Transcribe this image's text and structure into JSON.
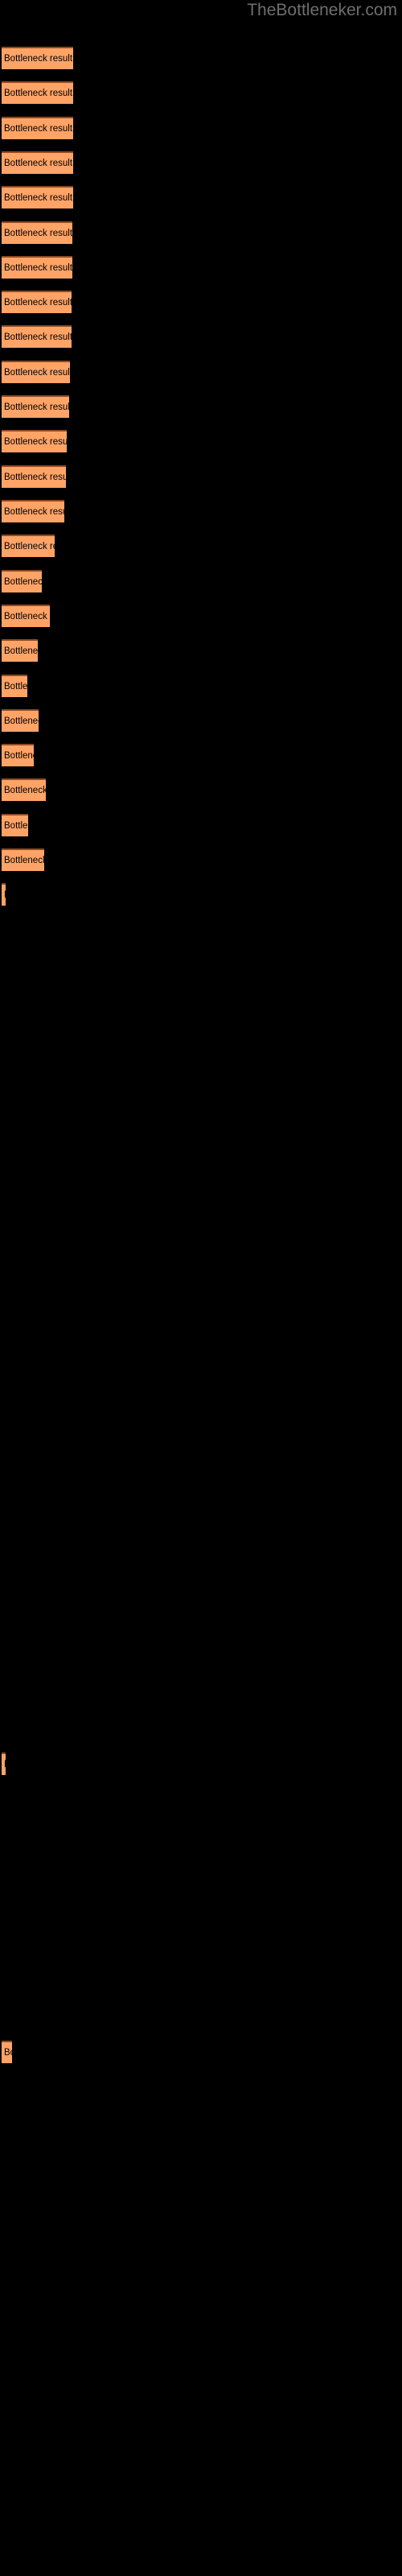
{
  "watermark": {
    "text": "TheBottleneker.com"
  },
  "colors": {
    "background": "#000000",
    "bar_fill": "#ffa366",
    "bar_edge": "#8f4a20",
    "label_text": "#000000",
    "watermark_text": "#6e6e6e"
  },
  "bar_label": "Bottleneck result",
  "chart_data": {
    "type": "bar",
    "orientation": "horizontal",
    "title": "",
    "subtitle": "",
    "xlabel": "",
    "ylabel": "",
    "grid": false,
    "legend": null,
    "axis_visible": false,
    "tick_labels": [],
    "bar_text": "Bottleneck result",
    "xlim": [
      0,
      500
    ],
    "categories": [
      "bar-1",
      "bar-2",
      "bar-3",
      "bar-4",
      "bar-5",
      "bar-6",
      "bar-7",
      "bar-8",
      "bar-9",
      "bar-10",
      "bar-11",
      "bar-12",
      "bar-13",
      "bar-14",
      "bar-15",
      "bar-16",
      "bar-17",
      "bar-18",
      "bar-19",
      "bar-20",
      "bar-21",
      "bar-22",
      "bar-23",
      "bar-24",
      "bar-25",
      "bar-26",
      "bar-27"
    ],
    "values": [
      89,
      89,
      89,
      89,
      89,
      88,
      88,
      87,
      87,
      85,
      84,
      81,
      80,
      78,
      66,
      50,
      60,
      45,
      32,
      46,
      40,
      55,
      33,
      53,
      5,
      5,
      13
    ],
    "bars": [
      {
        "name": "bar-1",
        "top": 58,
        "width": 89,
        "height": 28,
        "label": "Bottleneck result"
      },
      {
        "name": "bar-2",
        "top": 101,
        "width": 89,
        "height": 28,
        "label": "Bottleneck result"
      },
      {
        "name": "bar-3",
        "top": 145,
        "width": 89,
        "height": 28,
        "label": "Bottleneck result"
      },
      {
        "name": "bar-4",
        "top": 188,
        "width": 89,
        "height": 28,
        "label": "Bottleneck result"
      },
      {
        "name": "bar-5",
        "top": 231,
        "width": 89,
        "height": 28,
        "label": "Bottleneck result"
      },
      {
        "name": "bar-6",
        "top": 275,
        "width": 88,
        "height": 28,
        "label": "Bottleneck result"
      },
      {
        "name": "bar-7",
        "top": 318,
        "width": 88,
        "height": 28,
        "label": "Bottleneck result"
      },
      {
        "name": "bar-8",
        "top": 361,
        "width": 87,
        "height": 28,
        "label": "Bottleneck result"
      },
      {
        "name": "bar-9",
        "top": 404,
        "width": 87,
        "height": 28,
        "label": "Bottleneck result"
      },
      {
        "name": "bar-10",
        "top": 448,
        "width": 85,
        "height": 28,
        "label": "Bottleneck result"
      },
      {
        "name": "bar-11",
        "top": 491,
        "width": 84,
        "height": 28,
        "label": "Bottleneck result"
      },
      {
        "name": "bar-12",
        "top": 534,
        "width": 81,
        "height": 28,
        "label": "Bottleneck result"
      },
      {
        "name": "bar-13",
        "top": 578,
        "width": 80,
        "height": 28,
        "label": "Bottleneck result"
      },
      {
        "name": "bar-14",
        "top": 621,
        "width": 78,
        "height": 28,
        "label": "Bottleneck result"
      },
      {
        "name": "bar-15",
        "top": 664,
        "width": 66,
        "height": 28,
        "label": "Bottleneck result"
      },
      {
        "name": "bar-16",
        "top": 708,
        "width": 50,
        "height": 28,
        "label": "Bottleneck result"
      },
      {
        "name": "bar-17",
        "top": 751,
        "width": 60,
        "height": 28,
        "label": "Bottleneck result"
      },
      {
        "name": "bar-18",
        "top": 794,
        "width": 45,
        "height": 28,
        "label": "Bottleneck result"
      },
      {
        "name": "bar-19",
        "top": 838,
        "width": 32,
        "height": 28,
        "label": "Bottleneck result"
      },
      {
        "name": "bar-20",
        "top": 881,
        "width": 46,
        "height": 28,
        "label": "Bottleneck result"
      },
      {
        "name": "bar-21",
        "top": 924,
        "width": 40,
        "height": 28,
        "label": "Bottleneck result"
      },
      {
        "name": "bar-22",
        "top": 967,
        "width": 55,
        "height": 28,
        "label": "Bottleneck result"
      },
      {
        "name": "bar-23",
        "top": 1011,
        "width": 33,
        "height": 28,
        "label": "Bottleneck result"
      },
      {
        "name": "bar-24",
        "top": 1054,
        "width": 53,
        "height": 28,
        "label": "Bottleneck result"
      },
      {
        "name": "bar-25",
        "top": 1097,
        "width": 5,
        "height": 28,
        "label": "Bottleneck result"
      },
      {
        "name": "bar-26",
        "top": 2177,
        "width": 5,
        "height": 28,
        "label": "Bottleneck result"
      },
      {
        "name": "bar-27",
        "top": 2535,
        "width": 13,
        "height": 28,
        "label": "Bottleneck result"
      }
    ]
  }
}
